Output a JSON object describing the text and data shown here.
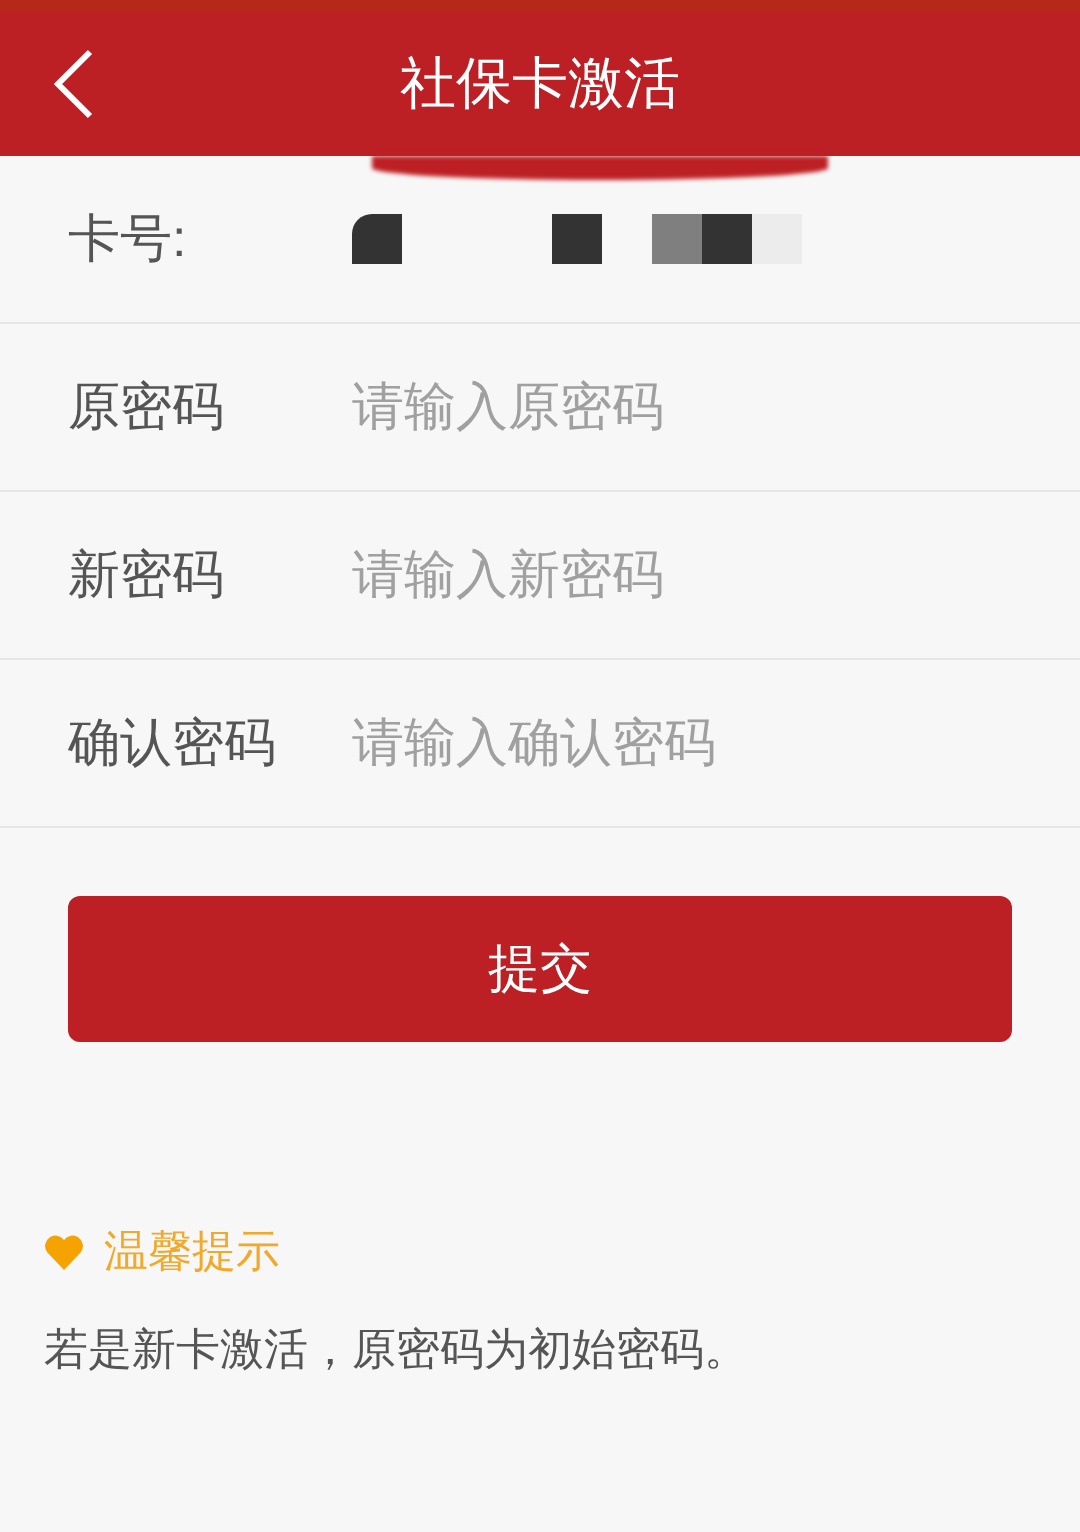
{
  "header": {
    "title": "社保卡激活"
  },
  "card_number": {
    "label": "卡号:"
  },
  "fields": [
    {
      "label": "原密码",
      "placeholder": "请输入原密码"
    },
    {
      "label": "新密码",
      "placeholder": "请输入新密码"
    },
    {
      "label": "确认密码",
      "placeholder": "请输入确认密码"
    }
  ],
  "submit_button": "提交",
  "tip": {
    "title": "温馨提示",
    "text": "若是新卡激活，原密码为初始密码。"
  }
}
